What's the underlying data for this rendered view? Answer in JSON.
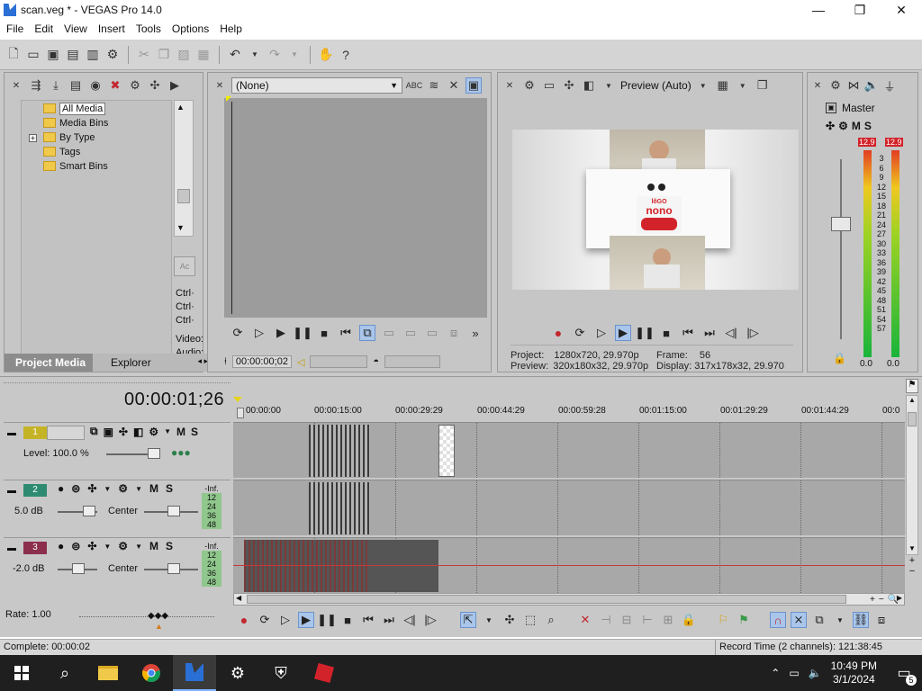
{
  "window": {
    "title": "scan.veg * - VEGAS Pro 14.0",
    "minimize": "—",
    "maximize": "❐",
    "close": "✕"
  },
  "menu": [
    "File",
    "Edit",
    "View",
    "Insert",
    "Tools",
    "Options",
    "Help"
  ],
  "project_media": {
    "tree": [
      {
        "label": "All Media",
        "selected": true
      },
      {
        "label": "Media Bins"
      },
      {
        "label": "By Type",
        "expandable": true
      },
      {
        "label": "Tags"
      },
      {
        "label": "Smart Bins"
      }
    ],
    "side_labels": [
      "Ctrl·",
      "Ctrl·",
      "Ctrl·",
      "Video:",
      "Audio:"
    ],
    "tabs": [
      "Project Media",
      "Explorer"
    ]
  },
  "trimmer": {
    "dropdown_value": "(None)",
    "timecode": "00:00:00;02"
  },
  "preview": {
    "mode": "Preview (Auto)",
    "project_label": "Project:",
    "project_value": "1280x720, 29.970p",
    "preview_label": "Preview:",
    "preview_value": "320x180x32, 29.970p",
    "frame_label": "Frame:",
    "frame_value": "56",
    "display_label": "Display:",
    "display_value": "317x178x32, 29.970",
    "product_text_top": "lõGO",
    "product_text_main": "nono"
  },
  "master": {
    "label": "Master",
    "peak_left": "12.9",
    "peak_right": "12.9",
    "scale": [
      "3",
      "6",
      "9",
      "12",
      "15",
      "18",
      "21",
      "24",
      "27",
      "30",
      "33",
      "36",
      "39",
      "42",
      "45",
      "48",
      "51",
      "54",
      "57"
    ],
    "bottom_left": "0.0",
    "bottom_right": "0.0"
  },
  "timeline": {
    "cursor_time": "00:00:01;26",
    "ruler": [
      "00:00:00",
      "00:00:15:00",
      "00:00:29:29",
      "00:00:44:29",
      "00:00:59:28",
      "00:01:15:00",
      "00:01:29:29",
      "00:01:44:29",
      "00:0"
    ],
    "tracks": [
      {
        "num": "1",
        "level": "Level: 100.0 %",
        "color": "#c5b326"
      },
      {
        "num": "2",
        "volume": "5.0 dB",
        "pan": "Center",
        "color": "#2e8b72",
        "meter": [
          "-Inf.",
          "12",
          "24",
          "36",
          "48"
        ]
      },
      {
        "num": "3",
        "volume": "-2.0 dB",
        "pan": "Center",
        "color": "#8c2f4d",
        "meter": [
          "-Inf.",
          "12",
          "24",
          "36",
          "48"
        ]
      }
    ],
    "rate": "Rate: 1.00"
  },
  "status": {
    "left": "Complete: 00:00:02",
    "right": "Record Time (2 channels): 121:38:45"
  },
  "taskbar": {
    "time": "10:49 PM",
    "date": "3/1/2024",
    "notif_count": "5"
  }
}
